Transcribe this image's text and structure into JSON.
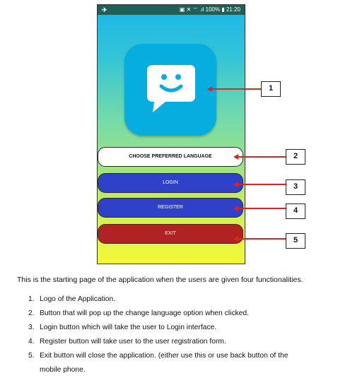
{
  "status_bar": {
    "left_icon": "notification-icon",
    "right_text": "100%",
    "time": "21:20"
  },
  "app": {
    "logo_icon": "chat-bubble-smile-icon",
    "buttons": {
      "language": "CHOOSE PREFERRED LANGUAGE",
      "login": "LOGIN",
      "register": "REGISTER",
      "exit": "EXIT"
    }
  },
  "callouts": [
    "1",
    "2",
    "3",
    "4",
    "5"
  ],
  "colors": {
    "login": "#2f40c9",
    "register": "#2f40c9",
    "exit": "#b12323",
    "logo": "#06aee0",
    "arrow": "#e0241b"
  },
  "description": {
    "intro": "This is the starting page of the application when the users are given four functionalities.",
    "items": [
      "Logo of the Application.",
      "Button that will pop up the change language option when clicked.",
      "Login button which will take the user to Login interface.",
      "Register button will take user to the user registration form.",
      "Exit button will close the application. (either use this or use back button of the",
      "mobile phone."
    ]
  }
}
